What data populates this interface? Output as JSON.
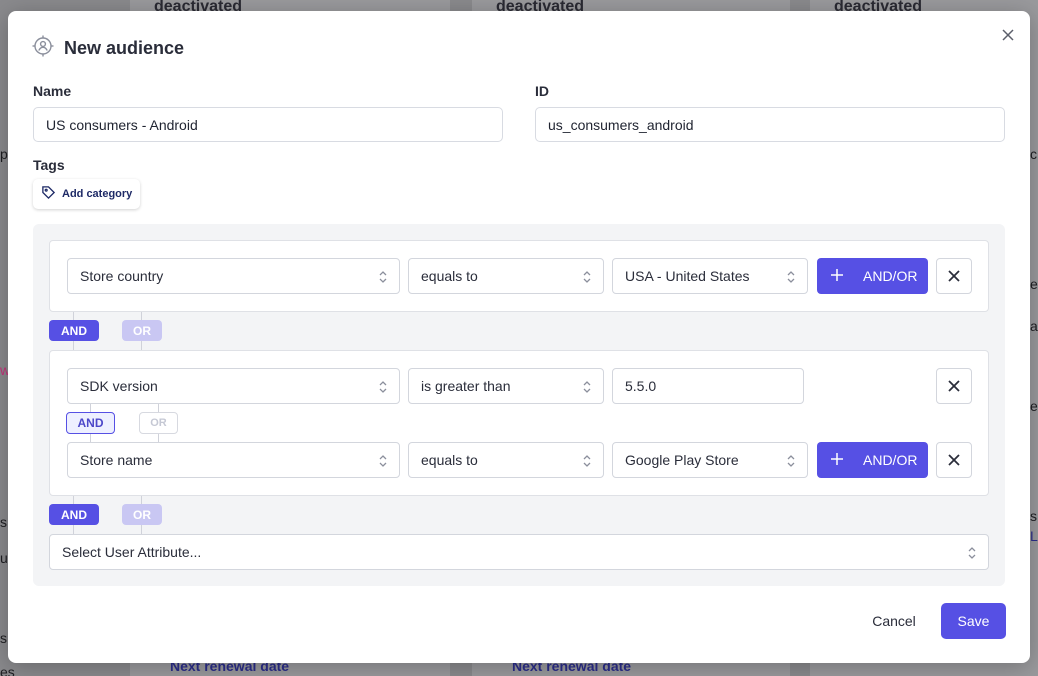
{
  "background": {
    "columns": [
      {
        "title": "deactivated",
        "footer": "Next renewal date"
      },
      {
        "title": "deactivated",
        "footer": "Next renewal date"
      },
      {
        "title": "deactivated",
        "footer": ""
      }
    ],
    "edge_fragments": [
      "p",
      "w",
      "s",
      "ur",
      "s",
      "es",
      "c",
      "e",
      "ac",
      "e",
      "s",
      "L"
    ]
  },
  "modal": {
    "title": "New audience",
    "title_icon": "audience-target-icon",
    "close_icon": "close-icon"
  },
  "form": {
    "name_label": "Name",
    "name_value": "US consumers - Android",
    "id_label": "ID",
    "id_value": "us_consumers_android",
    "tags_label": "Tags",
    "add_category_label": "Add category"
  },
  "rules": {
    "group1": {
      "conditions": [
        {
          "attribute": "Store country",
          "operator": "equals to",
          "value": "USA - United States"
        }
      ]
    },
    "group2": {
      "conditions": [
        {
          "attribute": "SDK version",
          "operator": "is greater than",
          "value": "5.5.0"
        },
        {
          "attribute": "Store name",
          "operator": "equals to",
          "value": "Google Play Store"
        }
      ]
    },
    "and_label": "AND",
    "or_label": "OR",
    "andor_label": "AND/OR",
    "select_attribute_placeholder": "Select User Attribute..."
  },
  "footer": {
    "cancel_label": "Cancel",
    "save_label": "Save"
  },
  "colors": {
    "accent": "#5650e4",
    "accent_light": "#c9c7f3"
  }
}
